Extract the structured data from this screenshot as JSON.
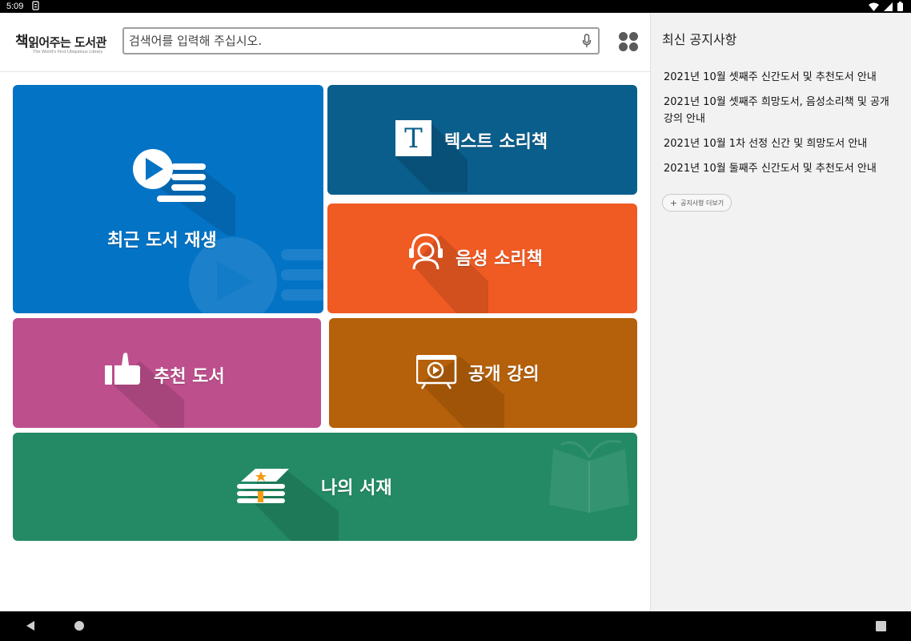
{
  "status_bar": {
    "time": "5:09"
  },
  "header": {
    "logo": {
      "big_char": "책",
      "rest": "읽어주는 도서관",
      "tagline": "The World's First Ubiquitous Library"
    },
    "search": {
      "placeholder": "검색어를 입력해 주십시오.",
      "value": ""
    }
  },
  "tiles": {
    "recent": {
      "label": "최근 도서 재생",
      "color": "#0373c5",
      "icon": "play-list-icon"
    },
    "text_book": {
      "label": "텍스트 소리책",
      "color": "#0a5e8c",
      "icon": "text-t-icon"
    },
    "voice_book": {
      "label": "음성 소리책",
      "color": "#f05a23",
      "icon": "headset-person-icon"
    },
    "recommend": {
      "label": "추천 도서",
      "color": "#bd4f8c",
      "icon": "thumbs-up-icon"
    },
    "lecture": {
      "label": "공개 강의",
      "color": "#b5600a",
      "icon": "video-screen-icon"
    },
    "my_shelf": {
      "label": "나의 서재",
      "color": "#238a65",
      "icon": "books-stack-icon"
    }
  },
  "sidebar": {
    "title": "최신 공지사항",
    "notices": [
      "2021년 10월 셋째주 신간도서 및 추천도서 안내",
      "2021년 10월 셋째주 희망도서, 음성소리책 및 공개 강의 안내",
      "2021년 10월 1차 선정 신간 및 희망도서 안내",
      "2021년 10월 둘째주 신간도서 및 추천도서 안내"
    ],
    "more_label": "공지사항 더보기"
  }
}
